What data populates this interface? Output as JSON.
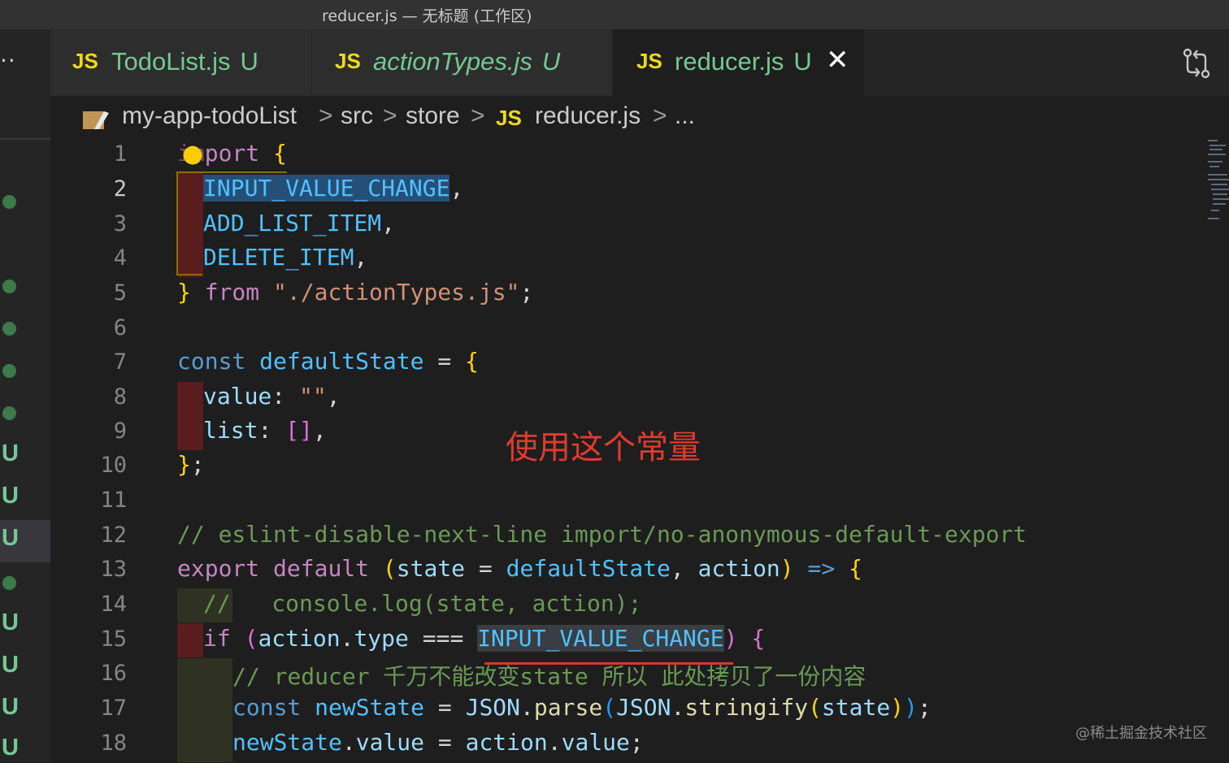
{
  "window": {
    "title": "reducer.js — 无标题 (工作区)"
  },
  "tabs": [
    {
      "icon": "JS",
      "name": "TodoList.js",
      "status": "U"
    },
    {
      "icon": "JS",
      "name": "actionTypes.js",
      "status": "U"
    },
    {
      "icon": "JS",
      "name": "reducer.js",
      "status": "U",
      "close": "✕"
    }
  ],
  "activity_bar": {
    "more": "··"
  },
  "breadcrumb": {
    "items": [
      "my-app-todoList",
      "src",
      "store",
      "reducer.js",
      "..."
    ],
    "file_icon": "JS",
    "separator": ">"
  },
  "line_numbers": [
    "1",
    "2",
    "3",
    "4",
    "5",
    "6",
    "7",
    "8",
    "9",
    "10",
    "11",
    "12",
    "13",
    "14",
    "15",
    "16",
    "17",
    "18"
  ],
  "code": {
    "l1_import": "im",
    "l1_port": "port",
    "l1_brace": "{",
    "l2_name": "INPUT_VALUE_CHANGE",
    "comma": ",",
    "l3_name": "ADD_LIST_ITEM",
    "l4_name": "DELETE_ITEM",
    "l5_close": "}",
    "l5_from": "from",
    "l5_path": "\"./actionTypes.js\"",
    "semi": ";",
    "l7_const": "const",
    "l7_name": "defaultState",
    "eq": "=",
    "l7_open": "{",
    "l8_key": "value",
    "colon": ":",
    "l8_val": "\"\"",
    "l9_key": "list",
    "l9_open": "[",
    "l9_close": "]",
    "l10_close": "}",
    "l12_comment": "// eslint-disable-next-line import/no-anonymous-default-export",
    "l13_export": "export",
    "l13_default": "default",
    "paren_open": "(",
    "paren_close": ")",
    "l13_state": "state",
    "l13_default_state": "defaultState",
    "l13_action": "action",
    "l13_arrow": "=>",
    "l13_brace": "{",
    "l14_comment": "//   console.log(state, action);",
    "l15_if": "if",
    "l15_action": "action",
    "dot": ".",
    "l15_type": "type",
    "l15_op": "===",
    "l15_const": "INPUT_VALUE_CHANGE",
    "l15_brace": "{",
    "l16_comment": "// reducer 千万不能改变state 所以 此处拷贝了一份内容",
    "l17_const": "const",
    "l17_var": "newState",
    "l17_json": "JSON",
    "l17_parse": "parse",
    "l17_stringify": "stringify",
    "l17_state": "state",
    "l18_var": "newState",
    "l18_prop": "value",
    "l18_action": "action",
    "l18_val": "value"
  },
  "annotation": "使用这个常量",
  "watermark": "@稀土掘金技术社区",
  "colors": {
    "accent_untracked": "#73c991",
    "js_icon": "#f1d91a",
    "annotation": "#e03b2f"
  }
}
